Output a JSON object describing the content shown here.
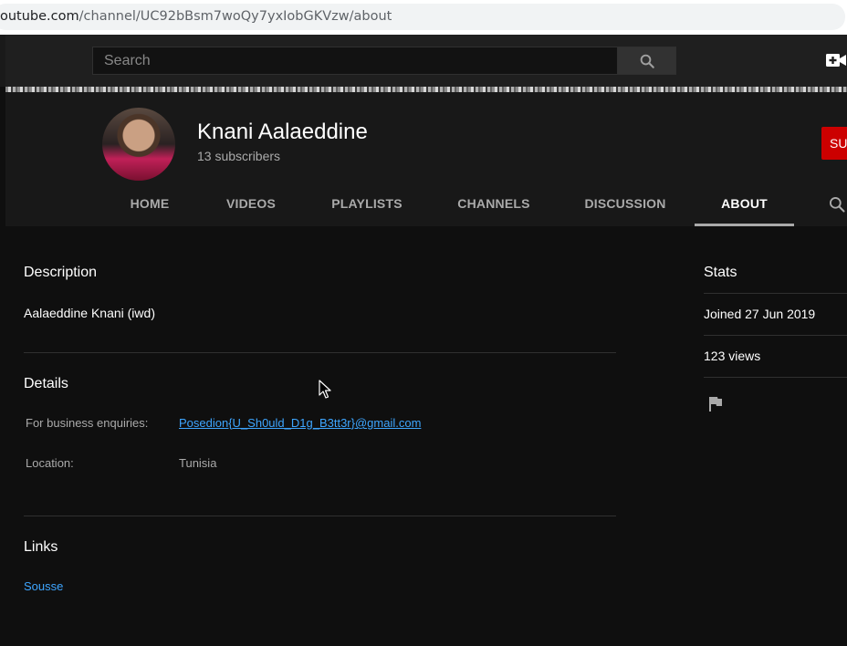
{
  "browser": {
    "url_domain": "outube.com",
    "url_path": "/channel/UC92bBsm7woQy7yxIobGKVzw/about"
  },
  "masthead": {
    "search_placeholder": "Search",
    "search_icon": "search-icon",
    "create_icon": "video-camera-plus-icon"
  },
  "channel": {
    "name": "Knani Aalaeddine",
    "subscribers": "13 subscribers",
    "subscribe_label": "SU",
    "subscribe_color": "#cc0000"
  },
  "tabs": [
    {
      "label": "HOME"
    },
    {
      "label": "VIDEOS"
    },
    {
      "label": "PLAYLISTS"
    },
    {
      "label": "CHANNELS"
    },
    {
      "label": "DISCUSSION"
    },
    {
      "label": "ABOUT",
      "active": true
    }
  ],
  "about": {
    "description_title": "Description",
    "description_text": "Aalaeddine Knani (iwd)",
    "details_title": "Details",
    "business_label": "For business enquiries:",
    "business_email": "Posedion{U_Sh0uld_D1g_B3tt3r}@gmail.com",
    "location_label": "Location:",
    "location_value": "Tunisia",
    "links_title": "Links",
    "links": [
      "Sousse"
    ]
  },
  "stats": {
    "title": "Stats",
    "joined": "Joined 27 Jun 2019",
    "views": "123 views",
    "flag_icon": "flag-icon"
  },
  "colors": {
    "background": "#0f0f0f",
    "header": "#181818",
    "link": "#3ea6ff",
    "secondary_text": "#aaaaaa"
  }
}
